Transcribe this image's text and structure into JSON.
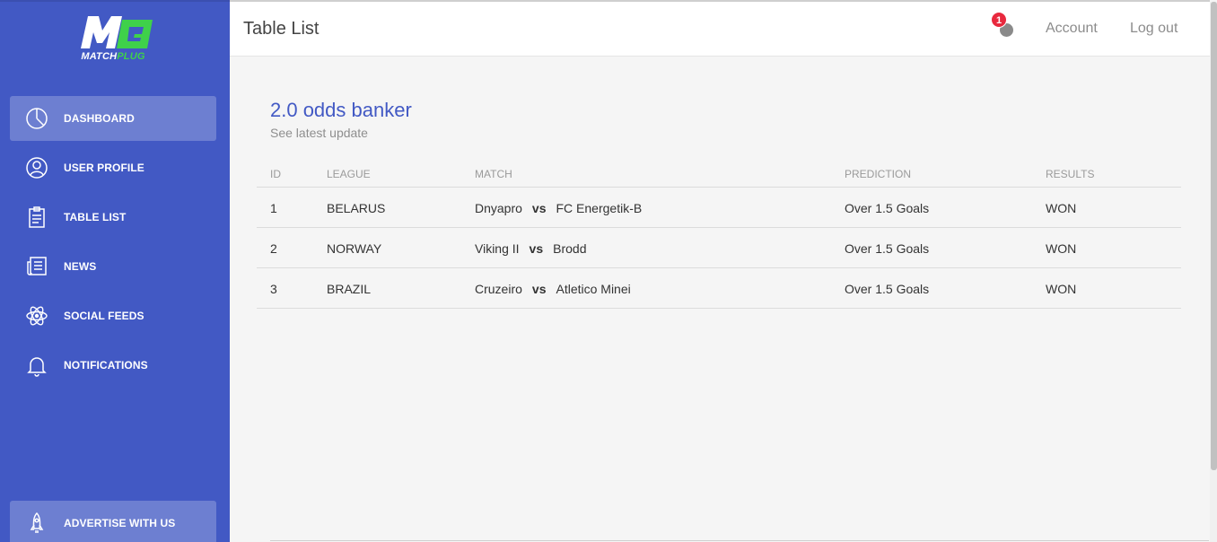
{
  "logo": {
    "mark": "M",
    "word_prefix": "MATCH",
    "word_suffix": "PLUG"
  },
  "sidebar": {
    "items": [
      {
        "label": "DASHBOARD",
        "icon": "pie-chart-icon",
        "active": true
      },
      {
        "label": "USER PROFILE",
        "icon": "user-icon",
        "active": false
      },
      {
        "label": "TABLE LIST",
        "icon": "clipboard-icon",
        "active": false
      },
      {
        "label": "NEWS",
        "icon": "newspaper-icon",
        "active": false
      },
      {
        "label": "SOCIAL FEEDS",
        "icon": "atom-icon",
        "active": false
      },
      {
        "label": "NOTIFICATIONS",
        "icon": "bell-icon",
        "active": false
      }
    ],
    "advertise": {
      "label": "ADVERTISE WITH US",
      "icon": "rocket-icon"
    }
  },
  "header": {
    "title": "Table List",
    "notification_count": "1",
    "account": "Account",
    "logout": "Log out"
  },
  "card": {
    "title": "2.0 odds banker",
    "subtitle": "See latest update",
    "columns": [
      "ID",
      "LEAGUE",
      "MATCH",
      "PREDICTION",
      "RESULTS"
    ],
    "vs": "vs",
    "rows": [
      {
        "id": "1",
        "league": "BELARUS",
        "home": "Dnyapro",
        "away": "FC Energetik-B",
        "prediction": "Over 1.5 Goals",
        "result": "WON"
      },
      {
        "id": "2",
        "league": "NORWAY",
        "home": "Viking II",
        "away": "Brodd",
        "prediction": "Over 1.5 Goals",
        "result": "WON"
      },
      {
        "id": "3",
        "league": "BRAZIL",
        "home": "Cruzeiro",
        "away": "Atletico Minei",
        "prediction": "Over 1.5 Goals",
        "result": "WON"
      }
    ]
  },
  "colors": {
    "sidebar": "#4259c4",
    "accent": "#4259c4",
    "logo_green": "#3fd14a",
    "badge": "#e8293e"
  }
}
